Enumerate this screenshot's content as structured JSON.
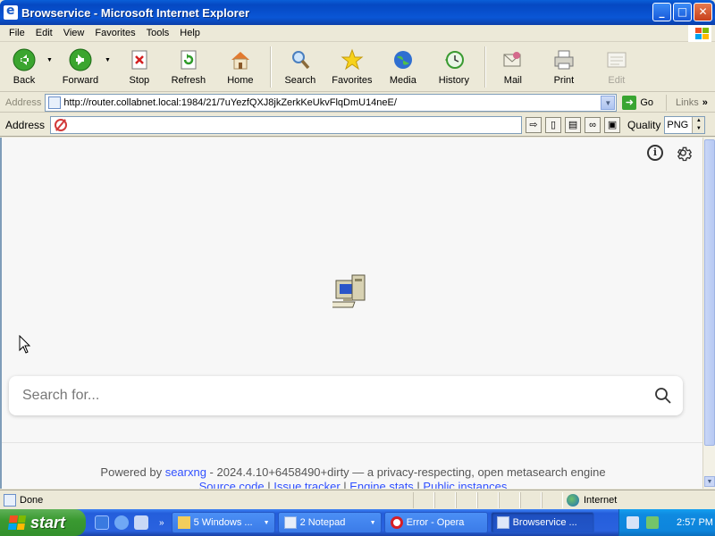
{
  "window": {
    "title": "Browservice - Microsoft Internet Explorer",
    "buttons": {
      "minimize": "_",
      "maximize": "□",
      "close": "✕"
    }
  },
  "menu": [
    "File",
    "Edit",
    "View",
    "Favorites",
    "Tools",
    "Help"
  ],
  "toolbar": {
    "back": "Back",
    "forward": "Forward",
    "stop": "Stop",
    "refresh": "Refresh",
    "home": "Home",
    "search": "Search",
    "favorites": "Favorites",
    "media": "Media",
    "history": "History",
    "mail": "Mail",
    "print": "Print",
    "edit": "Edit"
  },
  "address_bar": {
    "label": "Address",
    "url": "http://router.collabnet.local:1984/21/7uYezfQXJ8jkZerkKeUkvFlqDmU14neE/",
    "go": "Go",
    "links": "Links"
  },
  "plugin_bar": {
    "label": "Address",
    "value": "",
    "quality_label": "Quality",
    "quality_value": "PNG"
  },
  "page": {
    "search_placeholder": "Search for...",
    "footer": {
      "powered_by": "Powered by ",
      "searxng": "searxng",
      "version_text": " - 2024.4.10+6458490+dirty — a privacy-respecting, open metasearch engine",
      "links": [
        "Source code",
        "Issue tracker",
        "Engine stats",
        "Public instances"
      ],
      "separator": " | "
    }
  },
  "status_bar": {
    "text": "Done",
    "zone": "Internet"
  },
  "taskbar": {
    "start": "start",
    "tasks": [
      {
        "label": "5 Windows ...",
        "has_dropdown": true,
        "active": false
      },
      {
        "label": "2 Notepad",
        "has_dropdown": true,
        "active": false
      },
      {
        "label": "Error - Opera",
        "has_dropdown": false,
        "active": false
      },
      {
        "label": "Browservice ...",
        "has_dropdown": false,
        "active": true
      }
    ],
    "quick_chevron": "»",
    "clock": "2:57 PM"
  },
  "colors": {
    "titlebar": "#0a56d6",
    "taskbar": "#245edb",
    "start": "#3a9a31",
    "link": "#3050ff"
  }
}
